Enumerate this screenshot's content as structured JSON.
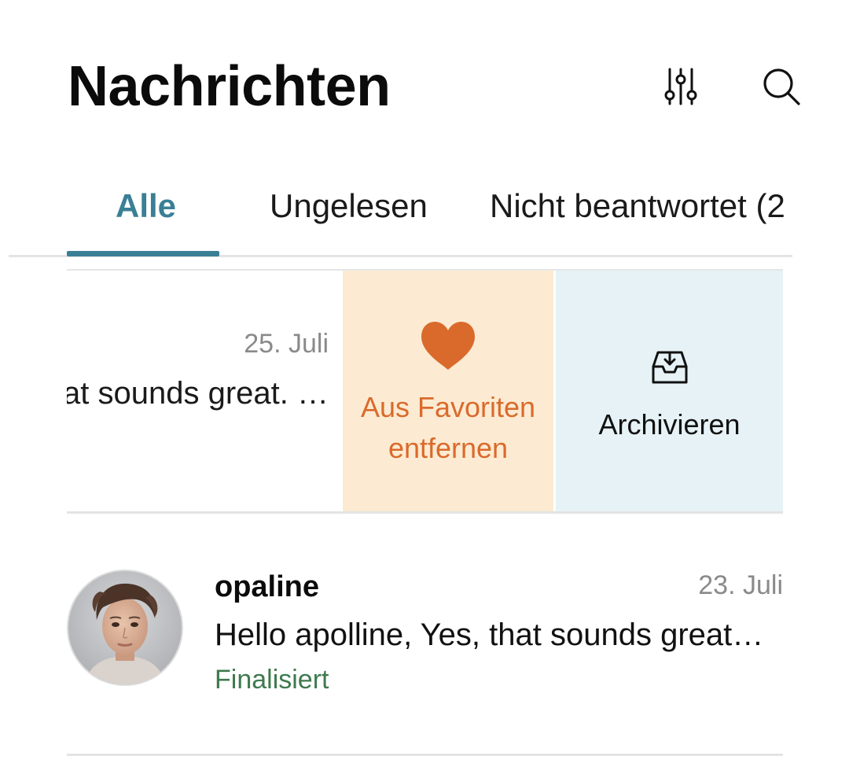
{
  "header": {
    "title": "Nachrichten",
    "filter_icon": "sliders-icon",
    "search_icon": "search-icon"
  },
  "tabs": [
    {
      "label": "Alle",
      "active": true
    },
    {
      "label": "Ungelesen",
      "active": false
    },
    {
      "label": "Nicht beantwortet (2",
      "active": false
    }
  ],
  "swiped_conversation": {
    "date": "25. Juli",
    "preview": "at sounds great. …",
    "actions": {
      "favorite": {
        "icon": "heart-icon",
        "label": "Aus Favoriten entfernen"
      },
      "archive": {
        "icon": "archive-inbox-icon",
        "label": "Archivieren"
      }
    }
  },
  "conversations": [
    {
      "name": "opaline",
      "date": "23. Juli",
      "preview": "Hello apolline, Yes, that sounds great…",
      "status": "Finalisiert",
      "avatar": "avatar-photo"
    }
  ],
  "colors": {
    "accent": "#3a7f95",
    "favorite_bg": "#fcebd2",
    "favorite_fg": "#da6a2c",
    "archive_bg": "#e6f2f5",
    "status_green": "#3e7a4e",
    "muted_text": "#8a8a8a"
  }
}
